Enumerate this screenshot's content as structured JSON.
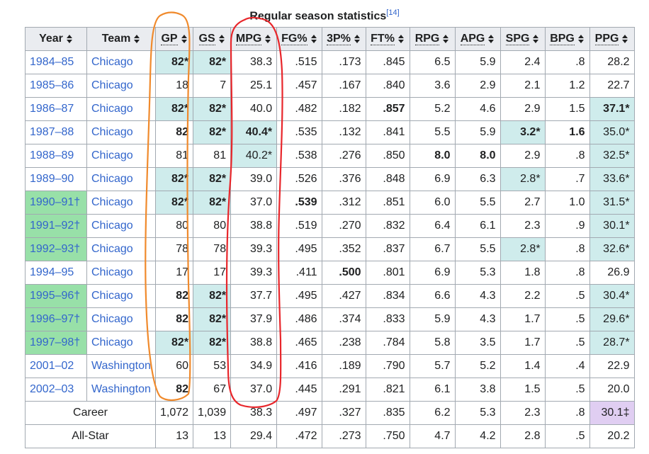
{
  "caption": {
    "title": "Regular season statistics",
    "ref": "[14]"
  },
  "headers": [
    "Year",
    "Team",
    "GP",
    "GS",
    "MPG",
    "FG%",
    "3P%",
    "FT%",
    "RPG",
    "APG",
    "SPG",
    "BPG",
    "PPG"
  ],
  "rows": [
    [
      "1984–85",
      "Chicago",
      "82*",
      "82*",
      "38.3",
      ".515",
      ".173",
      ".845",
      "6.5",
      "5.9",
      "2.4",
      ".8",
      "28.2"
    ],
    [
      "1985–86",
      "Chicago",
      "18",
      "7",
      "25.1",
      ".457",
      ".167",
      ".840",
      "3.6",
      "2.9",
      "2.1",
      "1.2",
      "22.7"
    ],
    [
      "1986–87",
      "Chicago",
      "82*",
      "82*",
      "40.0",
      ".482",
      ".182",
      ".857",
      "5.2",
      "4.6",
      "2.9",
      "1.5",
      "37.1*"
    ],
    [
      "1987–88",
      "Chicago",
      "82",
      "82*",
      "40.4*",
      ".535",
      ".132",
      ".841",
      "5.5",
      "5.9",
      "3.2*",
      "1.6",
      "35.0*"
    ],
    [
      "1988–89",
      "Chicago",
      "81",
      "81",
      "40.2*",
      ".538",
      ".276",
      ".850",
      "8.0",
      "8.0",
      "2.9",
      ".8",
      "32.5*"
    ],
    [
      "1989–90",
      "Chicago",
      "82*",
      "82*",
      "39.0",
      ".526",
      ".376",
      ".848",
      "6.9",
      "6.3",
      "2.8*",
      ".7",
      "33.6*"
    ],
    [
      "1990–91†",
      "Chicago",
      "82*",
      "82*",
      "37.0",
      ".539",
      ".312",
      ".851",
      "6.0",
      "5.5",
      "2.7",
      "1.0",
      "31.5*"
    ],
    [
      "1991–92†",
      "Chicago",
      "80",
      "80",
      "38.8",
      ".519",
      ".270",
      ".832",
      "6.4",
      "6.1",
      "2.3",
      ".9",
      "30.1*"
    ],
    [
      "1992–93†",
      "Chicago",
      "78",
      "78",
      "39.3",
      ".495",
      ".352",
      ".837",
      "6.7",
      "5.5",
      "2.8*",
      ".8",
      "32.6*"
    ],
    [
      "1994–95",
      "Chicago",
      "17",
      "17",
      "39.3",
      ".411",
      ".500",
      ".801",
      "6.9",
      "5.3",
      "1.8",
      ".8",
      "26.9"
    ],
    [
      "1995–96†",
      "Chicago",
      "82",
      "82*",
      "37.7",
      ".495",
      ".427",
      ".834",
      "6.6",
      "4.3",
      "2.2",
      ".5",
      "30.4*"
    ],
    [
      "1996–97†",
      "Chicago",
      "82",
      "82*",
      "37.9",
      ".486",
      ".374",
      ".833",
      "5.9",
      "4.3",
      "1.7",
      ".5",
      "29.6*"
    ],
    [
      "1997–98†",
      "Chicago",
      "82*",
      "82*",
      "38.8",
      ".465",
      ".238",
      ".784",
      "5.8",
      "3.5",
      "1.7",
      ".5",
      "28.7*"
    ],
    [
      "2001–02",
      "Washington",
      "60",
      "53",
      "34.9",
      ".416",
      ".189",
      ".790",
      "5.7",
      "5.2",
      "1.4",
      ".4",
      "22.9"
    ],
    [
      "2002–03",
      "Washington",
      "82",
      "67",
      "37.0",
      ".445",
      ".291",
      ".821",
      "6.1",
      "3.8",
      "1.5",
      ".5",
      "20.0"
    ]
  ],
  "totals": [
    [
      "Career",
      "1,072",
      "1,039",
      "38.3",
      ".497",
      ".327",
      ".835",
      "6.2",
      "5.3",
      "2.3",
      ".8",
      "30.1‡"
    ],
    [
      "All-Star",
      "13",
      "13",
      "29.4",
      ".472",
      ".273",
      ".750",
      "4.7",
      "4.2",
      "2.8",
      ".5",
      "20.2"
    ]
  ],
  "colors": {
    "highlight": "#cfecec",
    "champion": "#98e0a8",
    "record": "#e0cef2",
    "link": "#3366cc",
    "annotation_orange": "#f08a2c",
    "annotation_red": "#e8262b"
  },
  "icons": {
    "sort": "sort-arrows-icon"
  }
}
